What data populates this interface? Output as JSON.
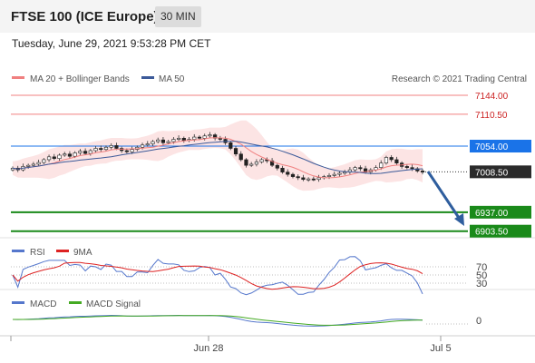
{
  "header": {
    "title": "FTSE 100 (ICE Europe)",
    "interval": "30 MIN",
    "datetime": "Tuesday, June 29, 2021 9:53:28 PM CET"
  },
  "chart_data": {
    "type": "candlestick",
    "main_panel": {
      "legend": [
        {
          "name": "MA 20 + Bollinger Bands",
          "color": "#f08080"
        },
        {
          "name": "MA 50",
          "color": "#3c5a99"
        }
      ],
      "copyright": "Research © 2021 Trading Central",
      "levels": [
        {
          "value": 7144.0,
          "label": "7144.00",
          "kind": "resistance",
          "color": "#f08080"
        },
        {
          "value": 7110.5,
          "label": "7110.50",
          "kind": "resistance",
          "color": "#f08080"
        },
        {
          "value": 7054.0,
          "label": "7054.00",
          "kind": "pivot",
          "color": "#1a73e8"
        },
        {
          "value": 7008.5,
          "label": "7008.50",
          "kind": "last",
          "color": "#222222"
        },
        {
          "value": 6937.0,
          "label": "6937.00",
          "kind": "target",
          "color": "#1a8a1a"
        },
        {
          "value": 6903.5,
          "label": "6903.50",
          "kind": "target",
          "color": "#1a8a1a"
        }
      ],
      "closes": [
        7015,
        7012,
        7018,
        7020,
        7022,
        7025,
        7030,
        7035,
        7032,
        7038,
        7040,
        7036,
        7042,
        7045,
        7041,
        7046,
        7050,
        7048,
        7052,
        7055,
        7050,
        7046,
        7044,
        7048,
        7052,
        7056,
        7058,
        7062,
        7065,
        7060,
        7062,
        7066,
        7068,
        7064,
        7066,
        7070,
        7068,
        7072,
        7074,
        7068,
        7066,
        7060,
        7050,
        7040,
        7030,
        7020,
        7022,
        7026,
        7030,
        7028,
        7020,
        7015,
        7008,
        7004,
        7000,
        6998,
        6995,
        6996,
        6995,
        6998,
        7000,
        7002,
        7004,
        7006,
        7008,
        7012,
        7016,
        7014,
        7008,
        7012,
        7016,
        7024,
        7034,
        7030,
        7024,
        7018,
        7016,
        7014,
        7010,
        7008
      ],
      "y_min": 6895,
      "y_max": 7152
    },
    "rsi_panel": {
      "legend": [
        {
          "name": "RSI",
          "color": "#5577cc"
        },
        {
          "name": "9MA",
          "color": "#dd2222"
        }
      ],
      "ticks": [
        "70",
        "50",
        "30"
      ]
    },
    "macd_panel": {
      "legend": [
        {
          "name": "MACD",
          "color": "#5577cc"
        },
        {
          "name": "MACD Signal",
          "color": "#44aa22"
        }
      ],
      "ticks": [
        "0"
      ]
    },
    "x_ticks": [
      "Jun 28",
      "Jul 5"
    ]
  }
}
